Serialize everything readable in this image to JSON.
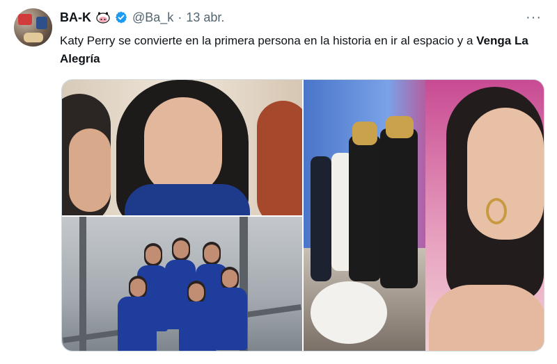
{
  "tweet": {
    "name": "BA-K",
    "handle": "@Ba_k",
    "separator": "·",
    "date": "13 abr.",
    "more": "···",
    "text_plain": "Katy Perry se convierte en la primera persona en la historia en ir al espacio y a ",
    "text_bold": "Venga La Alegría"
  },
  "icons": {
    "avatar": "avatar",
    "cow_emoji": "cow-emoji-icon",
    "verified": "verified-badge-icon",
    "more": "more-icon"
  },
  "colors": {
    "verified": "#1d9bf0",
    "text": "#0f1419",
    "muted": "#536471"
  }
}
